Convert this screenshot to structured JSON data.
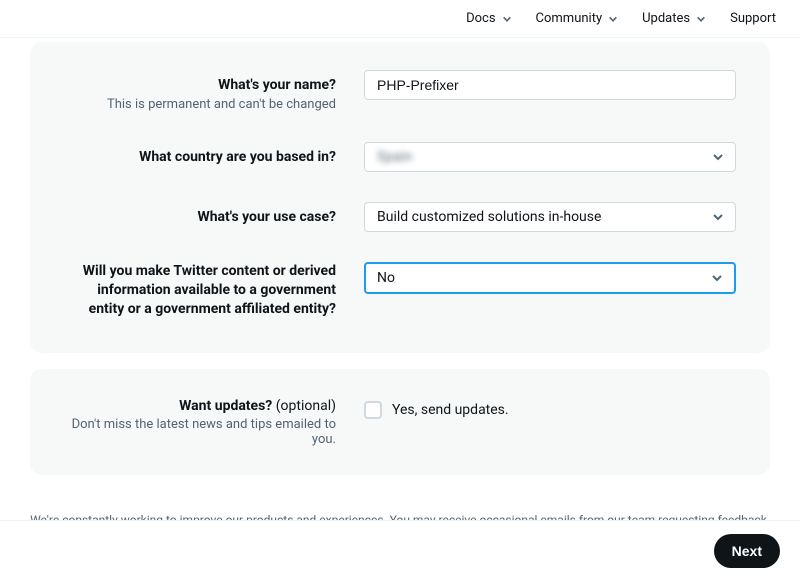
{
  "nav": {
    "docs": "Docs",
    "community": "Community",
    "updates": "Updates",
    "support": "Support"
  },
  "form": {
    "name": {
      "label": "What's your name?",
      "hint": "This is permanent and can't be changed",
      "value": "PHP-Prefixer"
    },
    "country": {
      "label": "What country are you based in?",
      "value": "Spain"
    },
    "usecase": {
      "label": "What's your use case?",
      "value": "Build customized solutions in-house"
    },
    "gov": {
      "label": "Will you make Twitter content or derived information available to a government entity or a government affiliated entity?",
      "value": "No"
    }
  },
  "updates_section": {
    "label": "Want updates?",
    "optional": " (optional)",
    "hint": "Don't miss the latest news and tips emailed to you.",
    "checkbox_label": "Yes, send updates."
  },
  "footer": "We're constantly working to improve our products and experiences. You may receive occasional emails from our team requesting feedback.",
  "next": "Next"
}
